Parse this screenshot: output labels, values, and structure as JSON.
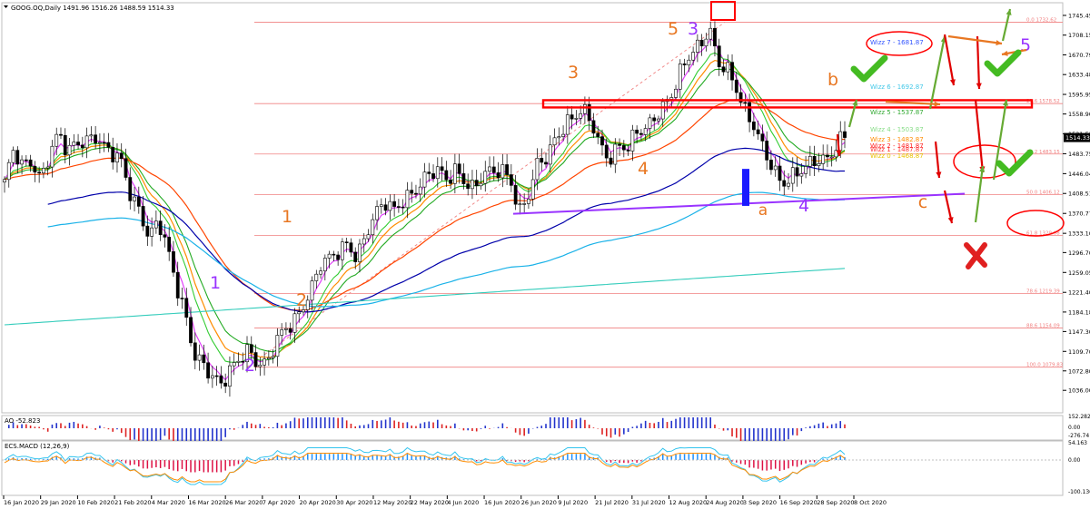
{
  "header": {
    "symbol_line": "GOOG.OQ,Daily  1491.96 1516.26 1488.59 1514.33"
  },
  "colors": {
    "ema5": "#e040fb",
    "ema21_orange": "#ff8c00",
    "ema_green": "#33cc33",
    "ema_dark_green": "#22aa22",
    "ema144_red": "#ff4500",
    "ema_blue": "#0000aa",
    "ema_cyan": "#1ab2e8",
    "ema_teal": "#33ccbb",
    "fib": "#f08080",
    "resistance": "#ff0000",
    "support": "#9933ff",
    "wave_orange": "#e87722",
    "wave_purple": "#9933ff",
    "arrow_red": "#e00000",
    "arrow_green": "#66aa33",
    "check_green": "#44bb22",
    "cross_red": "#e02020"
  },
  "chart_data": {
    "type": "candlestick",
    "title": "GOOG.OQ,Daily",
    "price_axis": {
      "ylim": [
        998.6,
        1766
      ],
      "ticks": [
        1036.0,
        1072.8,
        1109.7,
        1147.3,
        1184.18,
        1221.4,
        1259.05,
        1296.7,
        1333.1,
        1370.77,
        1408.51,
        1446.04,
        1483.75,
        1521.52,
        1558.9,
        1595.95,
        1633.48,
        1670.79,
        1708.15,
        1745.45
      ],
      "last_price": "1514.33"
    },
    "x_axis": {
      "labels": [
        "16 Jan 2020",
        "29 Jan 2020",
        "10 Feb 2020",
        "21 Feb 2020",
        "4 Mar 2020",
        "16 Mar 2020",
        "26 Mar 2020",
        "7 Apr 2020",
        "20 Apr 2020",
        "30 Apr 2020",
        "12 May 2020",
        "22 May 2020",
        "4 Jun 2020",
        "16 Jun 2020",
        "26 Jun 2020",
        "9 Jul 2020",
        "21 Jul 2020",
        "31 Jul 2020",
        "12 Aug 2020",
        "24 Aug 2020",
        "3 Sep 2020",
        "16 Sep 2020",
        "28 Sep 2020",
        "8 Oct 2020"
      ]
    },
    "price_path": [
      1430,
      1485,
      1455,
      1470,
      1440,
      1490,
      1520,
      1480,
      1500,
      1510,
      1525,
      1500,
      1480,
      1460,
      1400,
      1380,
      1330,
      1360,
      1300,
      1230,
      1180,
      1110,
      1090,
      1060,
      1040,
      1070,
      1100,
      1120,
      1090,
      1080,
      1120,
      1150,
      1170,
      1200,
      1230,
      1270,
      1280,
      1300,
      1320,
      1290,
      1330,
      1360,
      1390,
      1380,
      1400,
      1410,
      1420,
      1440,
      1450,
      1440,
      1460,
      1430,
      1410,
      1440,
      1450,
      1460,
      1440,
      1370,
      1400,
      1460,
      1480,
      1520,
      1540,
      1550,
      1560,
      1540,
      1500,
      1480,
      1500,
      1490,
      1520,
      1530,
      1560,
      1580,
      1600,
      1640,
      1670,
      1690,
      1730,
      1660,
      1640,
      1600,
      1560,
      1540,
      1500,
      1460,
      1420,
      1430,
      1450,
      1470,
      1480,
      1470,
      1490,
      1514
    ],
    "fibonacci": [
      {
        "label": "0.0 1732.62",
        "price": 1732.62
      },
      {
        "label": "23.6 1578.52",
        "price": 1578.52
      },
      {
        "label": "38.2 1483.15",
        "price": 1483.15
      },
      {
        "label": "50.0 1406.12",
        "price": 1406.12
      },
      {
        "label": "61.8 1329.08",
        "price": 1329.08
      },
      {
        "label": "78.6 1219.39",
        "price": 1219.39
      },
      {
        "label": "88.6 1154.09",
        "price": 1154.09
      },
      {
        "label": "100.0 1079.83",
        "price": 1079.83
      }
    ],
    "wizz_labels": [
      {
        "text": "Wizz 7 - 1681.87",
        "color": "#3355ff"
      },
      {
        "text": "Wizz 6 - 1692.87",
        "color": "#44c8e8"
      },
      {
        "text": "Wizz 5 - 1537.87",
        "color": "#33aa33"
      },
      {
        "text": "Wizz 4 - 1503.87",
        "color": "#88dd88"
      },
      {
        "text": "Wizz 3 - 1482.87",
        "color": "#ff8c00"
      },
      {
        "text": "Wizz 2 - 1481.87",
        "color": "#ff2222"
      },
      {
        "text": "Wizz 1 - 1487.87",
        "color": "#ff3333"
      },
      {
        "text": "Wizz 0 - 1468.87",
        "color": "#e8c400"
      }
    ],
    "wave_labels": [
      {
        "text": "1",
        "color": "#e87722"
      },
      {
        "text": "2",
        "color": "#e87722"
      },
      {
        "text": "3",
        "color": "#e87722"
      },
      {
        "text": "4",
        "color": "#e87722"
      },
      {
        "text": "5",
        "color": "#e87722"
      },
      {
        "text": "a",
        "color": "#e87722"
      },
      {
        "text": "b",
        "color": "#e87722"
      },
      {
        "text": "c",
        "color": "#e87722"
      },
      {
        "text": "1",
        "color": "#9933ff"
      },
      {
        "text": "2",
        "color": "#9933ff"
      },
      {
        "text": "3",
        "color": "#9933ff"
      },
      {
        "text": "4",
        "color": "#9933ff"
      },
      {
        "text": "5",
        "color": "#9933ff"
      }
    ],
    "ao_panel": {
      "label": "AO -52.823",
      "ticks": [
        "152.282",
        "0.00",
        "-276.74"
      ]
    },
    "macd_panel": {
      "label": "ECS.MACD (12,26,9)",
      "ticks": [
        "54.163",
        "0.00",
        "-100.1369"
      ]
    }
  }
}
